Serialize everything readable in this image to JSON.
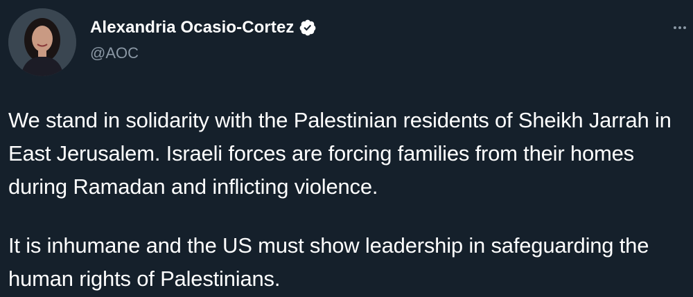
{
  "author": {
    "name": "Alexandria Ocasio-Cortez",
    "handle": "@AOC",
    "verified": true
  },
  "tweet": {
    "paragraphs": [
      "We stand in solidarity with the Palestinian residents of Sheikh Jarrah in East Jerusalem. Israeli forces are forcing families from their homes during Ramadan and inflicting violence.",
      "It is inhumane and the US must show leadership in safeguarding the human rights of Palestinians."
    ]
  },
  "icons": {
    "verified": "verified-badge-icon",
    "more": "more-options-icon"
  },
  "colors": {
    "background": "#15202b",
    "text": "#ffffff",
    "secondary": "#8b98a5"
  }
}
